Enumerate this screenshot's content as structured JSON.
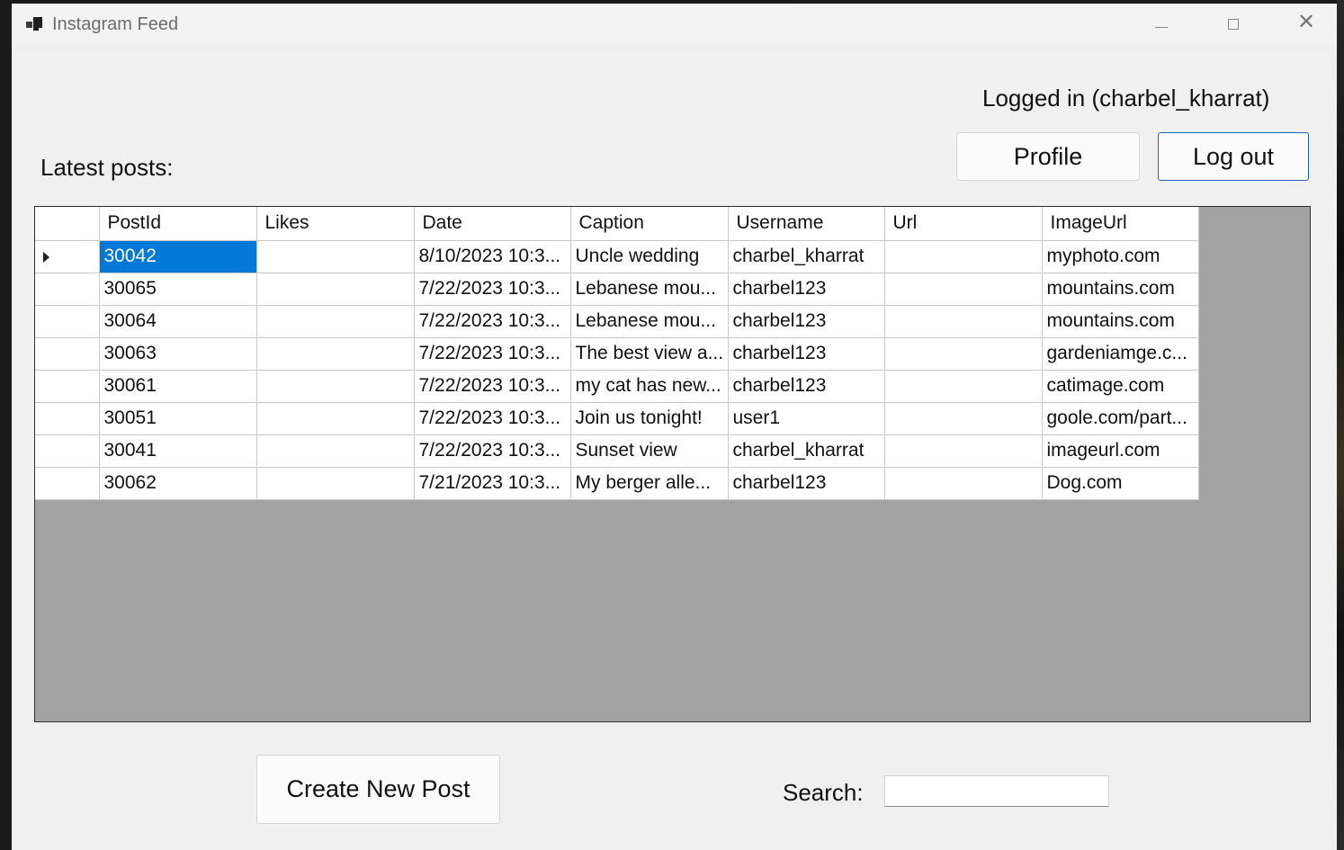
{
  "window": {
    "title": "Instagram Feed"
  },
  "header": {
    "logged_in_text": "Logged in (charbel_kharrat)",
    "profile_button": "Profile",
    "logout_button": "Log out"
  },
  "posts": {
    "label": "Latest posts:",
    "columns": [
      "PostId",
      "Likes",
      "Date",
      "Caption",
      "Username",
      "Url",
      "ImageUrl"
    ],
    "rows": [
      [
        "30042",
        "",
        "8/10/2023 10:3...",
        "Uncle wedding",
        "charbel_kharrat",
        "",
        "myphoto.com"
      ],
      [
        "30065",
        "",
        "7/22/2023 10:3...",
        "Lebanese mou...",
        "charbel123",
        "",
        "mountains.com"
      ],
      [
        "30064",
        "",
        "7/22/2023 10:3...",
        "Lebanese mou...",
        "charbel123",
        "",
        "mountains.com"
      ],
      [
        "30063",
        "",
        "7/22/2023 10:3...",
        "The best view a...",
        "charbel123",
        "",
        "gardeniamge.c..."
      ],
      [
        "30061",
        "",
        "7/22/2023 10:3...",
        "my cat has new...",
        "charbel123",
        "",
        "catimage.com"
      ],
      [
        "30051",
        "",
        "7/22/2023 10:3...",
        "Join us tonight!",
        "user1",
        "",
        "goole.com/part..."
      ],
      [
        "30041",
        "",
        "7/22/2023 10:3...",
        "Sunset view",
        "charbel_kharrat",
        "",
        "imageurl.com"
      ],
      [
        "30062",
        "",
        "7/21/2023 10:3...",
        "My berger alle...",
        "charbel123",
        "",
        "Dog.com"
      ]
    ]
  },
  "footer": {
    "create_button": "Create New Post",
    "search_label": "Search:",
    "search_value": ""
  }
}
